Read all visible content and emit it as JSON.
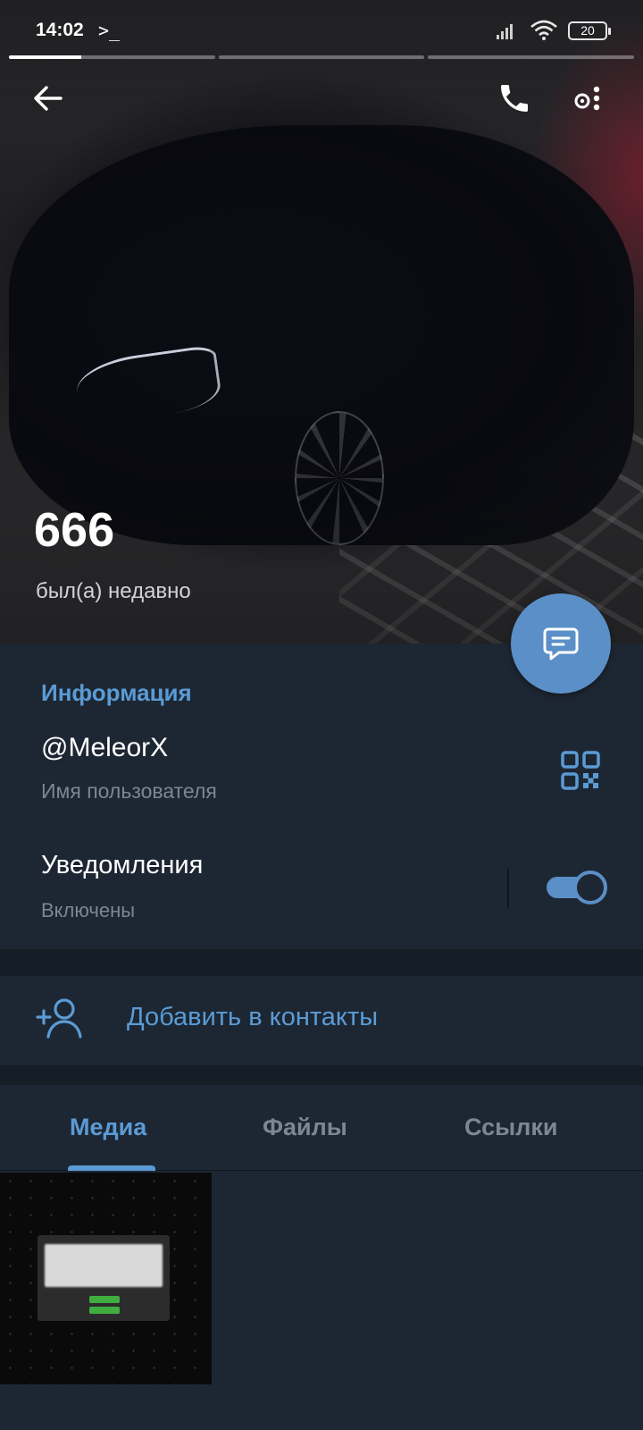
{
  "status_bar": {
    "time": "14:02",
    "terminal_glyph": ">_",
    "battery": "20"
  },
  "story_progress": {
    "segments": 3,
    "current_segment_fill": 1
  },
  "header": {
    "name": "666",
    "status": "был(а) недавно"
  },
  "info": {
    "section_title": "Информация",
    "username": "@MeleorX",
    "username_label": "Имя пользователя",
    "notifications_title": "Уведомления",
    "notifications_status": "Включены",
    "notifications_enabled": true
  },
  "actions": {
    "add_contact_label": "Добавить в контакты"
  },
  "tabs": [
    {
      "label": "Медиа",
      "active": true
    },
    {
      "label": "Файлы",
      "active": false
    },
    {
      "label": "Ссылки",
      "active": false
    }
  ],
  "media": {
    "count": 1
  },
  "colors": {
    "background": "#1d2733",
    "accent": "#5b9bd5",
    "fab": "#5b8fc7",
    "secondary_text": "#7c8792"
  },
  "icons": {
    "back": "arrow-left-icon",
    "call": "phone-icon",
    "more": "more-icon",
    "fab": "message-icon",
    "qr": "qr-code-icon",
    "add_contact": "add-user-icon"
  }
}
